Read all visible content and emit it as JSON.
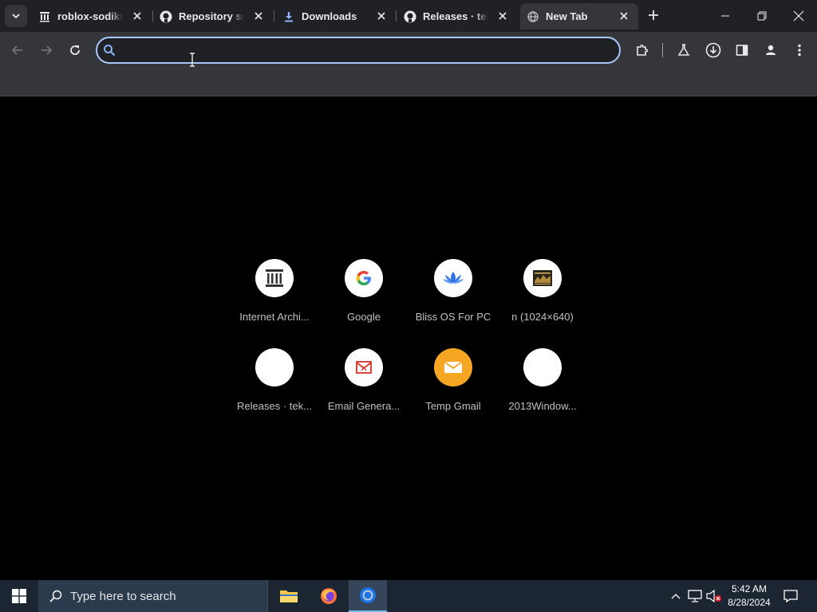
{
  "tabs": [
    {
      "title": "roblox-sodikm",
      "favicon": "archive-icon"
    },
    {
      "title": "Repository sea",
      "favicon": "github-icon"
    },
    {
      "title": "Downloads",
      "favicon": "download-icon"
    },
    {
      "title": "Releases · tekn",
      "favicon": "github-icon"
    },
    {
      "title": "New Tab",
      "favicon": "globe-icon"
    }
  ],
  "omnibox": {
    "value": "",
    "placeholder": ""
  },
  "shortcuts": [
    {
      "label": "Internet Archi...",
      "icon": "archive-icon"
    },
    {
      "label": "Google",
      "icon": "google-icon"
    },
    {
      "label": "Bliss OS For PC",
      "icon": "lotus-icon"
    },
    {
      "label": "n (1024×640)",
      "icon": "image-thumbnail-icon"
    },
    {
      "label": "Releases · tek...",
      "icon": "blank-icon"
    },
    {
      "label": "Email Genera...",
      "icon": "mail-generator-icon"
    },
    {
      "label": "Temp Gmail",
      "icon": "envelope-icon"
    },
    {
      "label": "2013Window...",
      "icon": "blank-icon"
    }
  ],
  "taskbar": {
    "search_placeholder": "Type here to search",
    "time": "5:42 AM",
    "date": "8/28/2024"
  },
  "colors": {
    "tabstrip": "#202124",
    "toolbar": "#35363a",
    "omnibox_border": "#a8c7fa",
    "taskbar": "#1c2633"
  }
}
